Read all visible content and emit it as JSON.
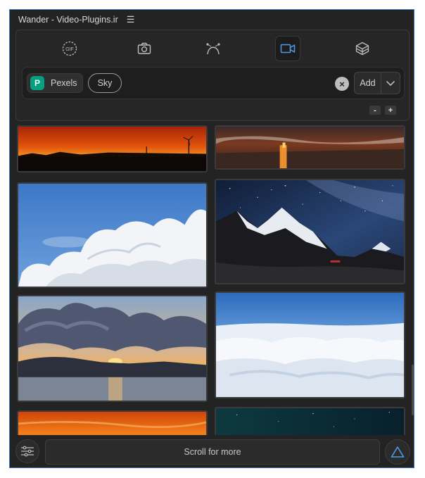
{
  "window": {
    "title": "Wander - Video-Plugins.ir",
    "menu_icon": "hamburger-icon"
  },
  "tabs": [
    {
      "name": "gif",
      "icon": "gif-icon",
      "label": "GIF",
      "active": false
    },
    {
      "name": "photo",
      "icon": "camera-icon",
      "active": false
    },
    {
      "name": "vector",
      "icon": "bezier-pen-icon",
      "active": false
    },
    {
      "name": "video",
      "icon": "video-camera-icon",
      "active": true
    },
    {
      "name": "3d",
      "icon": "cube-layers-icon",
      "active": false
    }
  ],
  "search": {
    "source_chip": {
      "label": "Pexels",
      "logo_letter": "P",
      "logo_color": "#05a081"
    },
    "tags": [
      {
        "label": "Sky"
      }
    ],
    "add_label": "Add"
  },
  "zoom": {
    "minus": "-",
    "plus": "+"
  },
  "results": [
    {
      "description": "sunset-silhouette-windmills"
    },
    {
      "description": "beach-sunset-waves"
    },
    {
      "description": "white-clouds-blue-sky"
    },
    {
      "description": "starry-night-mountain"
    },
    {
      "description": "sunset-clouds-lake"
    },
    {
      "description": "sea-of-clouds-aerial"
    },
    {
      "description": "orange-sky-partial"
    },
    {
      "description": "night-sky-partial"
    }
  ],
  "footer": {
    "scroll_label": "Scroll for more"
  },
  "colors": {
    "accent": "#3b78d6",
    "panel": "#262626",
    "background": "#232323"
  }
}
